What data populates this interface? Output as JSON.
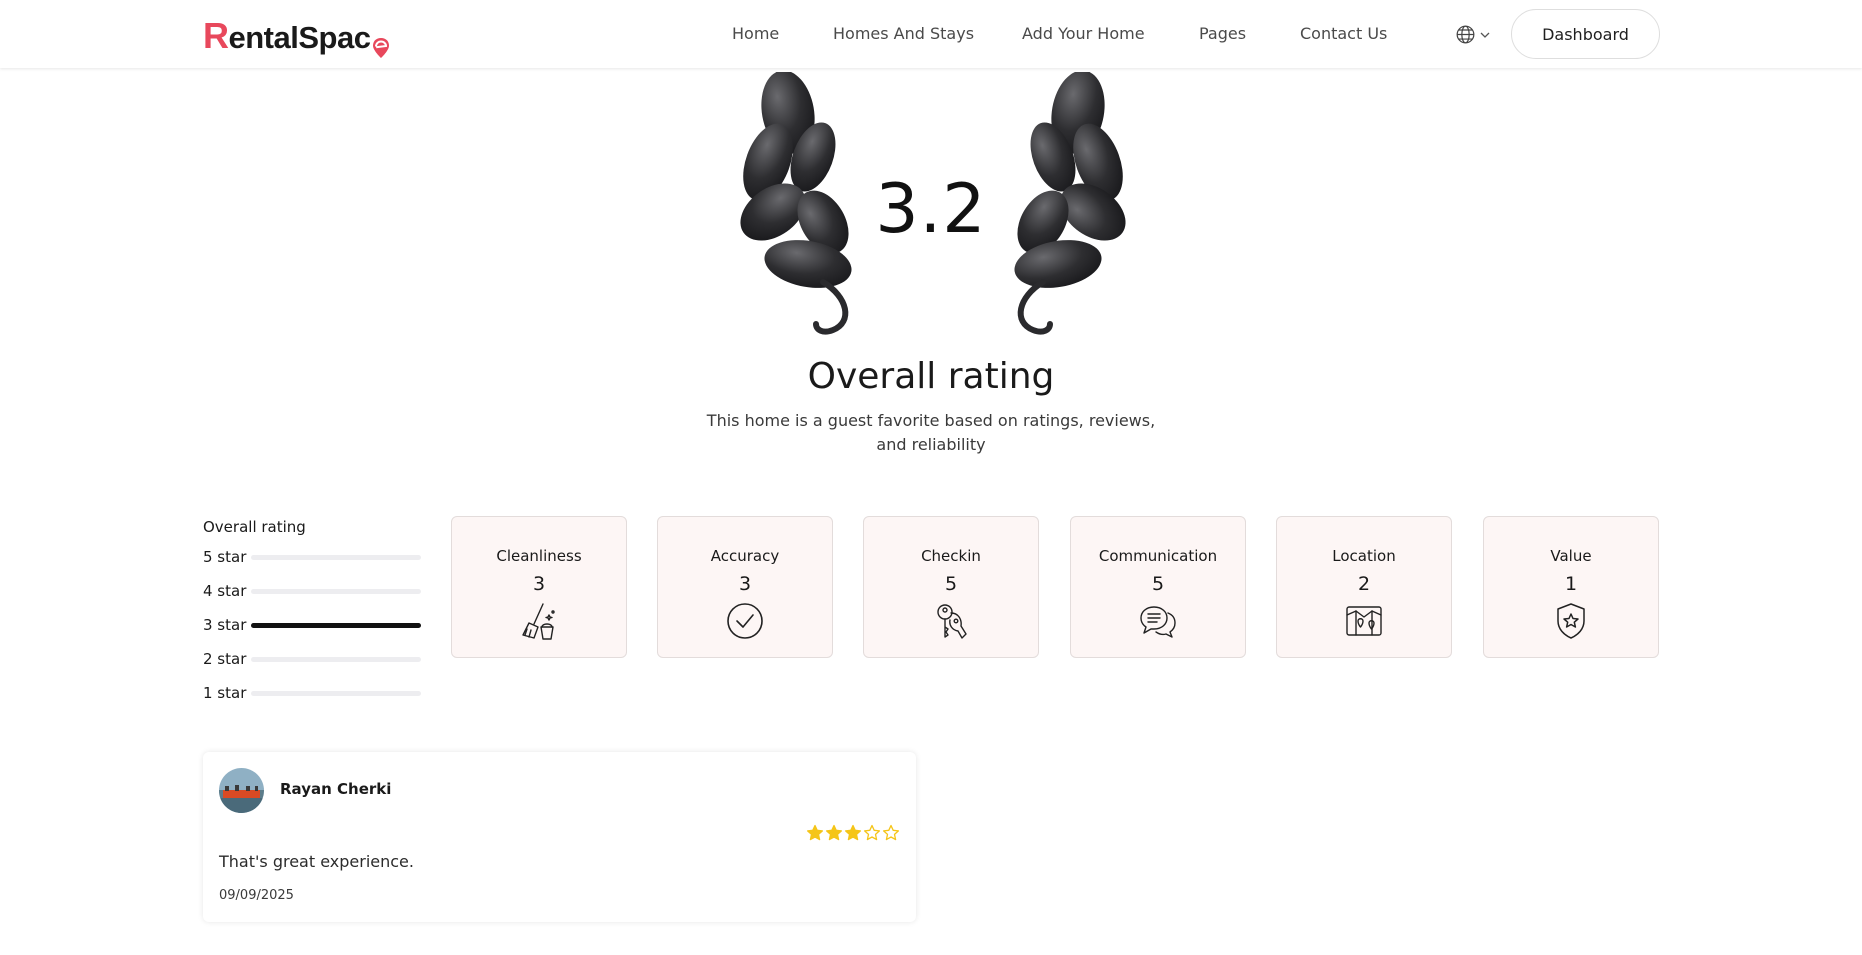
{
  "header": {
    "logo_initial": "R",
    "logo_rest": "entalSpac",
    "logo_tail": "e",
    "nav": [
      {
        "label": "Home"
      },
      {
        "label": "Homes And Stays"
      },
      {
        "label": "Add Your Home"
      },
      {
        "label": "Pages"
      },
      {
        "label": "Contact Us"
      }
    ],
    "language_icon": "globe-icon",
    "dashboard_label": "Dashboard"
  },
  "hero": {
    "score": "3.2",
    "title": "Overall rating",
    "subtitle": "This home is a guest favorite based on ratings, reviews, and reliability"
  },
  "breakdown": {
    "title": "Overall rating",
    "rows": [
      {
        "label": "5 star",
        "fraction": 0.0
      },
      {
        "label": "4 star",
        "fraction": 0.0
      },
      {
        "label": "3 star",
        "fraction": 1.0
      },
      {
        "label": "2 star",
        "fraction": 0.0
      },
      {
        "label": "1 star",
        "fraction": 0.0
      }
    ]
  },
  "categories": [
    {
      "name": "Cleanliness",
      "value": "3",
      "icon": "broom-icon"
    },
    {
      "name": "Accuracy",
      "value": "3",
      "icon": "check-circle-icon"
    },
    {
      "name": "Checkin",
      "value": "5",
      "icon": "keys-icon"
    },
    {
      "name": "Communication",
      "value": "5",
      "icon": "chat-bubbles-icon"
    },
    {
      "name": "Location",
      "value": "2",
      "icon": "map-icon"
    },
    {
      "name": "Value",
      "value": "1",
      "icon": "shield-star-icon"
    }
  ],
  "review": {
    "name": "Rayan Cherki",
    "rating": 3,
    "max_rating": 5,
    "text": "That's great experience.",
    "date": "09/09/2025"
  },
  "colors": {
    "brand": "#e8485c",
    "star": "#f5c518",
    "card_bg": "#fdf6f5"
  }
}
